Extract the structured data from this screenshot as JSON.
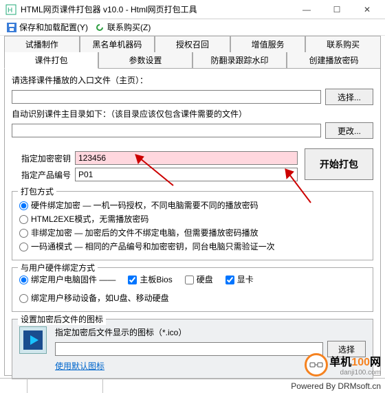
{
  "window": {
    "title": "HTML网页课件打包器 v10.0 - Html网页打包工具",
    "min": "—",
    "max": "☐",
    "close": "✕"
  },
  "menu": {
    "save_cfg": "保存和加载配置(Y)",
    "contact": "联系购买(Z)"
  },
  "tabs": {
    "r1": [
      "试播制作",
      "黑名单机器码",
      "授权召回",
      "增值服务",
      "联系购买"
    ],
    "r2": [
      "课件打包",
      "参数设置",
      "防翻录跟踪水印",
      "创建播放密码"
    ],
    "activeIndex": 0
  },
  "form": {
    "entry_label": "请选择课件播放的入口文件（主页）：",
    "entry_value": "",
    "choose": "选择...",
    "dir_label": "自动识别课件主目录如下：（该目录应该仅包含课件需要的文件）",
    "dir_value": "",
    "change": "更改...",
    "key_label": "指定加密密钥",
    "key_value": "123456",
    "pid_label": "指定产品编号",
    "pid_value": "P01",
    "pack": "开始打包"
  },
  "pack_mode": {
    "title": "打包方式",
    "opt1": "硬件绑定加密 — 一机一码授权，不同电脑需要不同的播放密码",
    "opt2": "HTML2EXE模式，无需播放密码",
    "opt3": "非绑定加密 — 加密后的文件不绑定电脑，但需要播放密码播放",
    "opt4": "一码通模式 — 相同的产品编号和加密密钥，同台电脑只需验证一次"
  },
  "hw_bind": {
    "title": "与用户硬件绑定方式",
    "opt_pc": "绑定用户电脑固件 ——",
    "cb_bios": "主板Bios",
    "cb_disk": "硬盘",
    "cb_gpu": "显卡",
    "opt_mobile": "绑定用户移动设备，如U盘、移动硬盘"
  },
  "icon": {
    "title": "设置加密后文件的图标",
    "path_label": "指定加密后文件显示的图标（*.ico）",
    "path_value": "",
    "choose": "选择",
    "default_link": "使用默认图标"
  },
  "footer": {
    "powered": "Powered By DRMsoft.cn"
  },
  "watermark": {
    "text": "单机100网",
    "url": "danji100.com"
  }
}
